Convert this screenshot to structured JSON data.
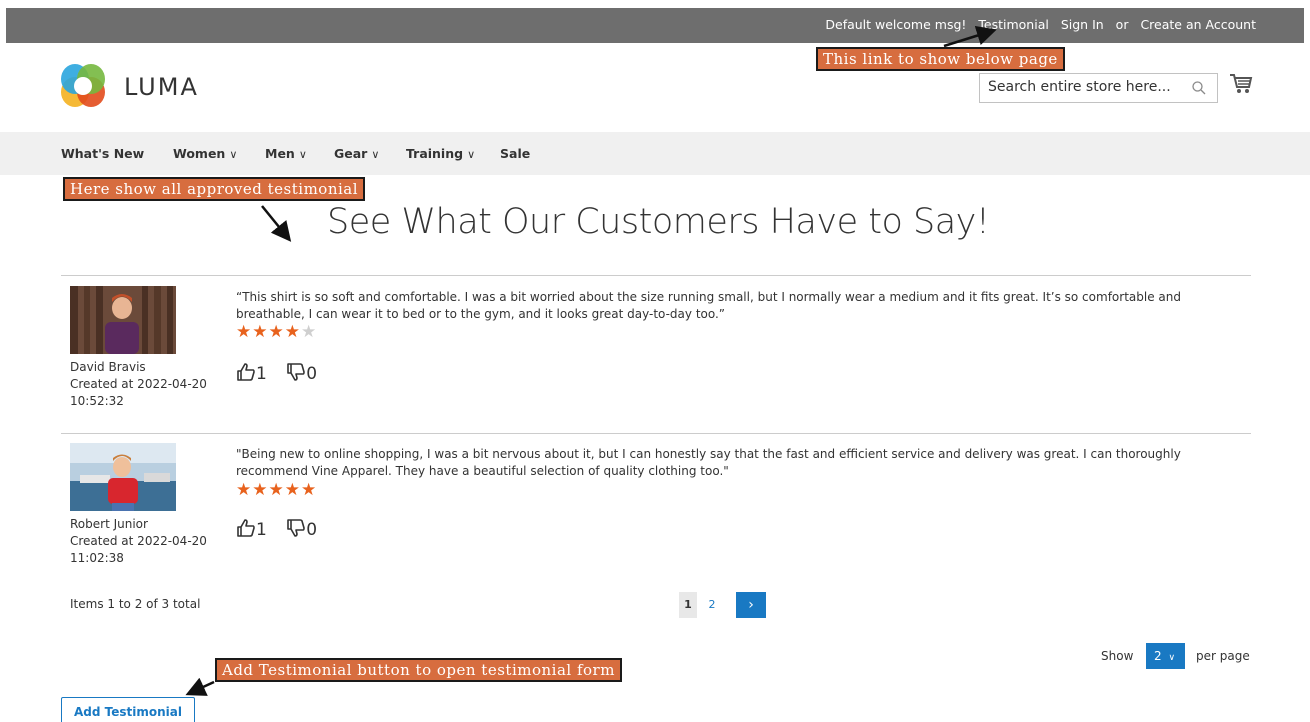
{
  "topbar": {
    "welcome": "Default welcome msg!",
    "testimonial_link": "Testimonial",
    "sign_in": "Sign In",
    "or": "or",
    "create_account": "Create an Account"
  },
  "header": {
    "logo_text": "LUMA",
    "search_placeholder": "Search entire store here..."
  },
  "nav": {
    "items": [
      "What's New",
      "Women",
      "Men",
      "Gear",
      "Training",
      "Sale"
    ]
  },
  "page": {
    "title": "See What Our Customers Have to Say!"
  },
  "testimonials": [
    {
      "quote": "“This shirt is so soft and comfortable. I was a bit worried about the size running small, but I normally wear a medium and it fits great. It’s so comfortable and breathable, I can wear it to bed or to the gym, and it looks great day-to-day too.”",
      "rating": 4,
      "likes": "1",
      "dislikes": "0",
      "name": "David Bravis",
      "created": "Created at 2022-04-20",
      "time": "10:52:32"
    },
    {
      "quote": "\"Being new to online shopping, I was a bit nervous about it, but I can honestly say that the fast and efficient service and delivery was great. I can thoroughly recommend Vine Apparel. They have a beautiful selection of quality clothing too.\"",
      "rating": 5,
      "likes": "1",
      "dislikes": "0",
      "name": "Robert Junior",
      "created": "Created at 2022-04-20",
      "time": "11:02:38"
    }
  ],
  "pagination": {
    "items_total": "Items 1 to 2 of 3 total",
    "current_page": "1",
    "other_page": "2",
    "next": "›"
  },
  "limiter": {
    "show_label": "Show",
    "value": "2",
    "per_page_label": "per page"
  },
  "add_button": "Add Testimonial",
  "annotations": {
    "link_note": "This link to show below page",
    "list_note": "Here show all approved testimonial",
    "button_note": "Add Testimonial button to open testimonial form"
  },
  "colors": {
    "accent": "#1979c3",
    "star": "#e8621d",
    "annotation": "#d76d3f"
  }
}
